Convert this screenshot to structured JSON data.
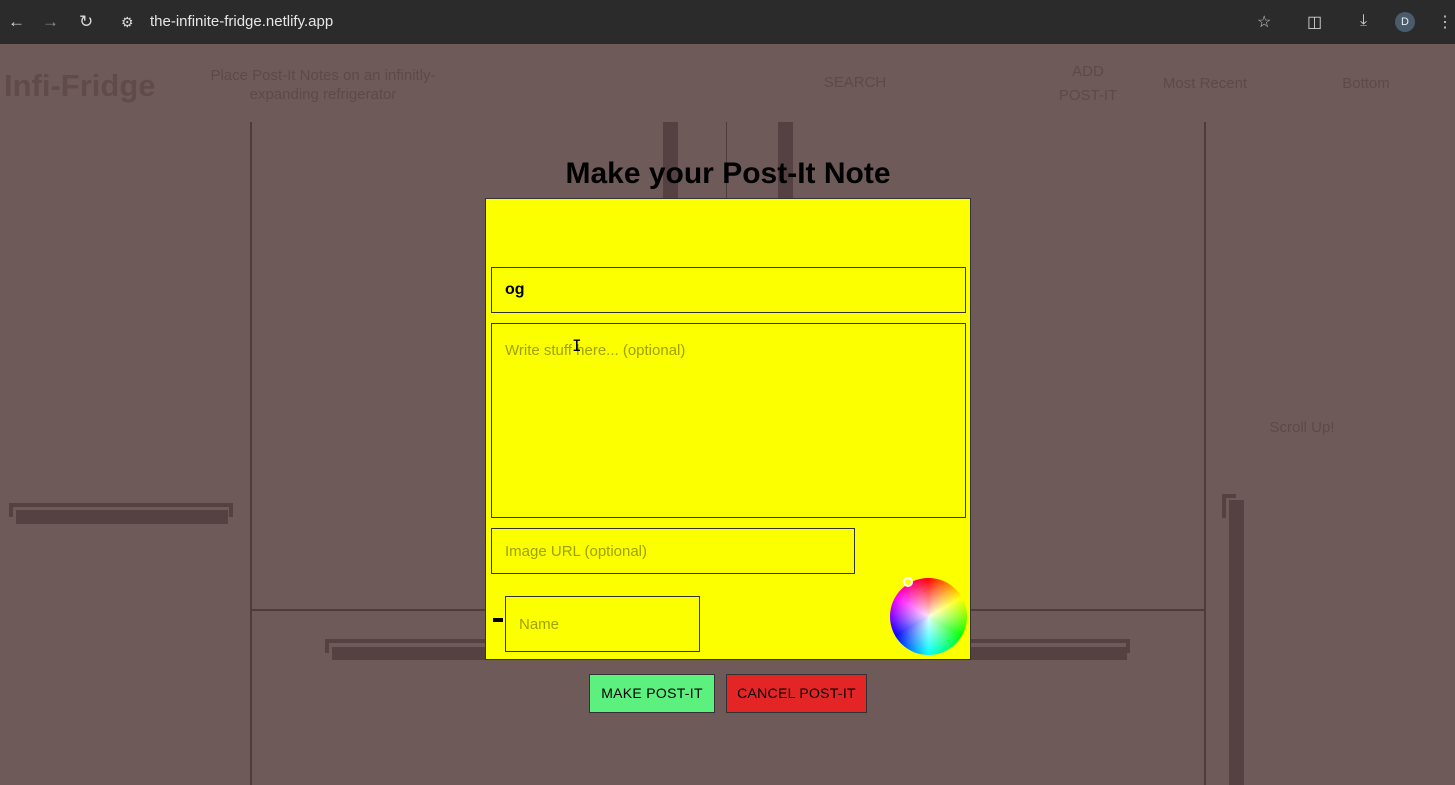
{
  "browser": {
    "url": "the-infinite-fridge.netlify.app",
    "profile_initial": "D"
  },
  "site": {
    "logo": "Infi-Fridge",
    "tagline": "Place Post-It Notes on an infinitly-expanding refrigerator",
    "nav": {
      "search": "SEARCH",
      "add_line1": "ADD",
      "add_line2": "POST-IT",
      "most_recent": "Most Recent",
      "bottom": "Bottom"
    },
    "scroll_hint": "Scroll Up!"
  },
  "modal": {
    "title": "Make your Post-It Note",
    "note_color": "#fbff00",
    "title_value": "og",
    "body_placeholder": "Write stuff here... (optional)",
    "image_placeholder": "Image URL (optional)",
    "name_placeholder": "Name",
    "make_label": "MAKE POST-IT",
    "cancel_label": "CANCEL POST-IT"
  },
  "colors": {
    "overlay": "#6f5a5a",
    "make_button": "#5cf07f",
    "cancel_button": "#e42525"
  }
}
